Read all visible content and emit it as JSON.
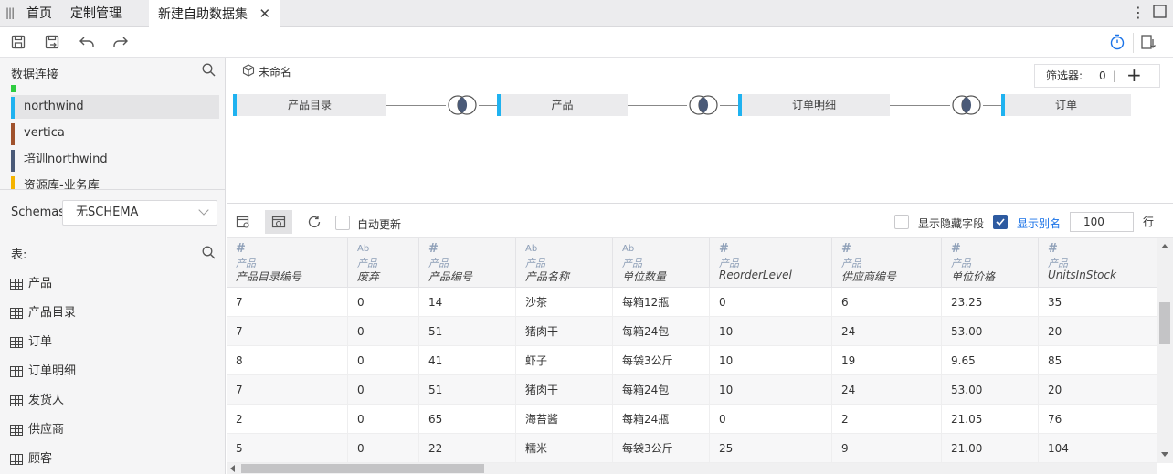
{
  "tabs": {
    "home": "首页",
    "custom": "定制管理",
    "active": "新建自助数据集"
  },
  "left": {
    "connections_title": "数据连接",
    "connections": [
      {
        "label": "",
        "color": "#2ecc40"
      },
      {
        "label": "northwind",
        "color": "#1fb2f0"
      },
      {
        "label": "vertica",
        "color": "#a0522d"
      },
      {
        "label": "培训northwind",
        "color": "#4a5a78"
      },
      {
        "label": "资源库-业务库",
        "color": "#f5b400"
      }
    ],
    "schemas_label": "Schemas",
    "schema_value": "无SCHEMA",
    "tables_title": "表:",
    "tables": [
      "产品",
      "产品目录",
      "订单",
      "订单明细",
      "发货人",
      "供应商",
      "顾客"
    ]
  },
  "canvas": {
    "dataset_name": "未命名",
    "filter_label": "筛选器:",
    "filter_count": "0",
    "nodes": [
      "产品目录",
      "产品",
      "订单明细",
      "订单"
    ]
  },
  "preview": {
    "auto_update": "自动更新",
    "show_hidden": "显示隐藏字段",
    "show_alias": "显示别名",
    "rows_value": "100",
    "rows_unit": "行",
    "columns": [
      {
        "type": "#",
        "source": "产品",
        "name": "产品目录编号"
      },
      {
        "type": "Ab",
        "source": "产品",
        "name": "废弃"
      },
      {
        "type": "#",
        "source": "产品",
        "name": "产品编号"
      },
      {
        "type": "Ab",
        "source": "产品",
        "name": "产品名称"
      },
      {
        "type": "Ab",
        "source": "产品",
        "name": "单位数量"
      },
      {
        "type": "#",
        "source": "产品",
        "name": "ReorderLevel"
      },
      {
        "type": "#",
        "source": "产品",
        "name": "供应商编号"
      },
      {
        "type": "#",
        "source": "产品",
        "name": "单位价格"
      },
      {
        "type": "#",
        "source": "产品",
        "name": "UnitsInStock"
      }
    ],
    "rows": [
      [
        "7",
        "0",
        "14",
        "沙茶",
        "每箱12瓶",
        "0",
        "6",
        "23.25",
        "35"
      ],
      [
        "7",
        "0",
        "51",
        "猪肉干",
        "每箱24包",
        "10",
        "24",
        "53.00",
        "20"
      ],
      [
        "8",
        "0",
        "41",
        "虾子",
        "每袋3公斤",
        "10",
        "19",
        "9.65",
        "85"
      ],
      [
        "7",
        "0",
        "51",
        "猪肉干",
        "每箱24包",
        "10",
        "24",
        "53.00",
        "20"
      ],
      [
        "2",
        "0",
        "65",
        "海苔酱",
        "每箱24瓶",
        "0",
        "2",
        "21.05",
        "76"
      ],
      [
        "5",
        "0",
        "22",
        "糯米",
        "每袋3公斤",
        "25",
        "9",
        "21.00",
        "104"
      ]
    ]
  },
  "colors": {
    "accent": "#1fb2f0",
    "checkbox": "#2d5aa0",
    "link": "#1a73e8"
  }
}
